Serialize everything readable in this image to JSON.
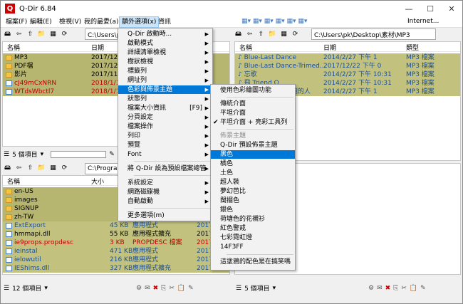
{
  "window": {
    "title": "Q-Dir 6.84",
    "icon_glyph": "Q",
    "min": "—",
    "max": "☐",
    "close": "✕"
  },
  "menubar": [
    "檔案(F)",
    "編輯(E)",
    "檢視(V)",
    "我的最愛(a)",
    "額外選項(x)",
    "資訊"
  ],
  "right_toolbar": {
    "internet": "Internet..."
  },
  "top_left": {
    "address": "C:\\Users\\pk\\Desktop\\素材\\",
    "col_name": "名稱",
    "col_date": "日期",
    "rows": [
      {
        "name": "MP3",
        "date": "2017/12/2"
      },
      {
        "name": "PDF檔",
        "date": "2017/12/2"
      },
      {
        "name": "影片",
        "date": "2017/11/1"
      },
      {
        "name": "cJ49mCxNRN",
        "date": "2018/1/11"
      },
      {
        "name": "WTdsWbctl7",
        "date": "2018/1/11"
      }
    ],
    "status": "5 個項目"
  },
  "top_right": {
    "address": "C:\\Users\\pk\\Desktop\\素材\\MP3",
    "col_name": "名稱",
    "col_date": "日期",
    "col_type": "類型",
    "rows": [
      {
        "name": "Blue-Last Dance",
        "date": "2014/2/27 下午 1",
        "type": "MP3 檔案"
      },
      {
        "name": "Blue-Last Dance-Trimed...",
        "date": "2017/12/22 下午 0",
        "type": "MP3 檔案"
      },
      {
        "name": "忘歌",
        "date": "2014/2/27 下午 10:31",
        "type": "MP3 檔案"
      },
      {
        "name": "飛 Triend O",
        "date": "2014/2/27 下午 10:31",
        "type": "MP3 檔案"
      },
      {
        "name": "蟲蟲-給我一個擁抱的人",
        "date": "2014/2/27 下午 1",
        "type": "MP3 檔案"
      }
    ]
  },
  "bottom_left": {
    "address": "C:\\Program",
    "col_name": "名稱",
    "col_size": "大小",
    "rows": [
      {
        "name": "en-US",
        "size": "",
        "type": "",
        "date": ""
      },
      {
        "name": "images",
        "size": "",
        "type": "",
        "date": ""
      },
      {
        "name": "SIGNUP",
        "size": "",
        "type": "",
        "date": ""
      },
      {
        "name": "zh-TW",
        "size": "",
        "type": "",
        "date": ""
      },
      {
        "name": "ExtExport",
        "size": "45 KB",
        "type": "應用程式",
        "date": "2017"
      },
      {
        "name": "hmmapi.dll",
        "size": "55 KB",
        "type": "應用程式擴充",
        "date": "2017"
      },
      {
        "name": "ie9props.propdesc",
        "size": "3 KB",
        "type": "PROPDESC 檔案",
        "date": "2017"
      },
      {
        "name": "ieinstal",
        "size": "471 KB",
        "type": "應用程式",
        "date": "2017"
      },
      {
        "name": "ielowutil",
        "size": "216 KB",
        "type": "應用程式",
        "date": "2017"
      },
      {
        "name": "IEShims.dll",
        "size": "327 KB",
        "type": "應用程式擴充",
        "date": "2017/9/2"
      }
    ],
    "status": "12 個項目"
  },
  "bottom_right": {
    "status": "5 個項目"
  },
  "extra_menu": {
    "items": [
      "Q-Dir 啟動時...",
      "啟動模式",
      "詳細清單檢視",
      "樹狀檢視",
      "標籤列",
      "網址列",
      "色彩與佈景主題",
      "狀態列",
      "檔案大小資訊",
      "分頁設定",
      "檔案操作",
      "列印",
      "預覽",
      "Font",
      "將 Q-Dir 設為預設檔案總管",
      "系統設定",
      "網路磁碟機",
      "自動啟動",
      "更多選項(m)"
    ],
    "shortcut": "[F9]"
  },
  "color_menu": {
    "items": [
      "使用色彩繪圖功能",
      "傳統介面",
      "平坦介面",
      "平坦介面 + 亮彩工具列",
      "佈景主題",
      "Q-Dir 預設佈景主題",
      "黑色",
      "橘色",
      "土色",
      "超人裝",
      "夢幻芭比",
      "閩擺色",
      "銀色",
      "荷塘色的花襯衫",
      "紅色警戒",
      "七彩霓虹燈",
      "14F3FF",
      "這塗鴉的配色是在搞笑嗎"
    ],
    "checked_mark": "✔"
  },
  "colors": {
    "accent": "#0078d7",
    "olive": "#b6b670",
    "red_text": "#c00000"
  }
}
